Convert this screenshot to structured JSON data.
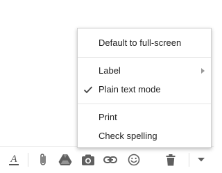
{
  "menu": {
    "items": [
      {
        "label": "Default to full-screen",
        "checked": false,
        "submenu": false
      },
      {
        "label": "Label",
        "checked": false,
        "submenu": true
      },
      {
        "label": "Plain text mode",
        "checked": true,
        "submenu": false
      },
      {
        "label": "Print",
        "checked": false,
        "submenu": false
      },
      {
        "label": "Check spelling",
        "checked": false,
        "submenu": false
      }
    ]
  },
  "toolbar": {
    "format_glyph": "A",
    "icons": [
      "formatting-options-icon",
      "attach-file-icon",
      "google-drive-icon",
      "insert-photo-icon",
      "insert-link-icon",
      "insert-emoji-icon",
      "discard-draft-icon",
      "more-options-icon"
    ]
  },
  "colors": {
    "menu_text": "#222222",
    "icon_gray": "#5f5f5f",
    "submenu_arrow": "#999999"
  }
}
